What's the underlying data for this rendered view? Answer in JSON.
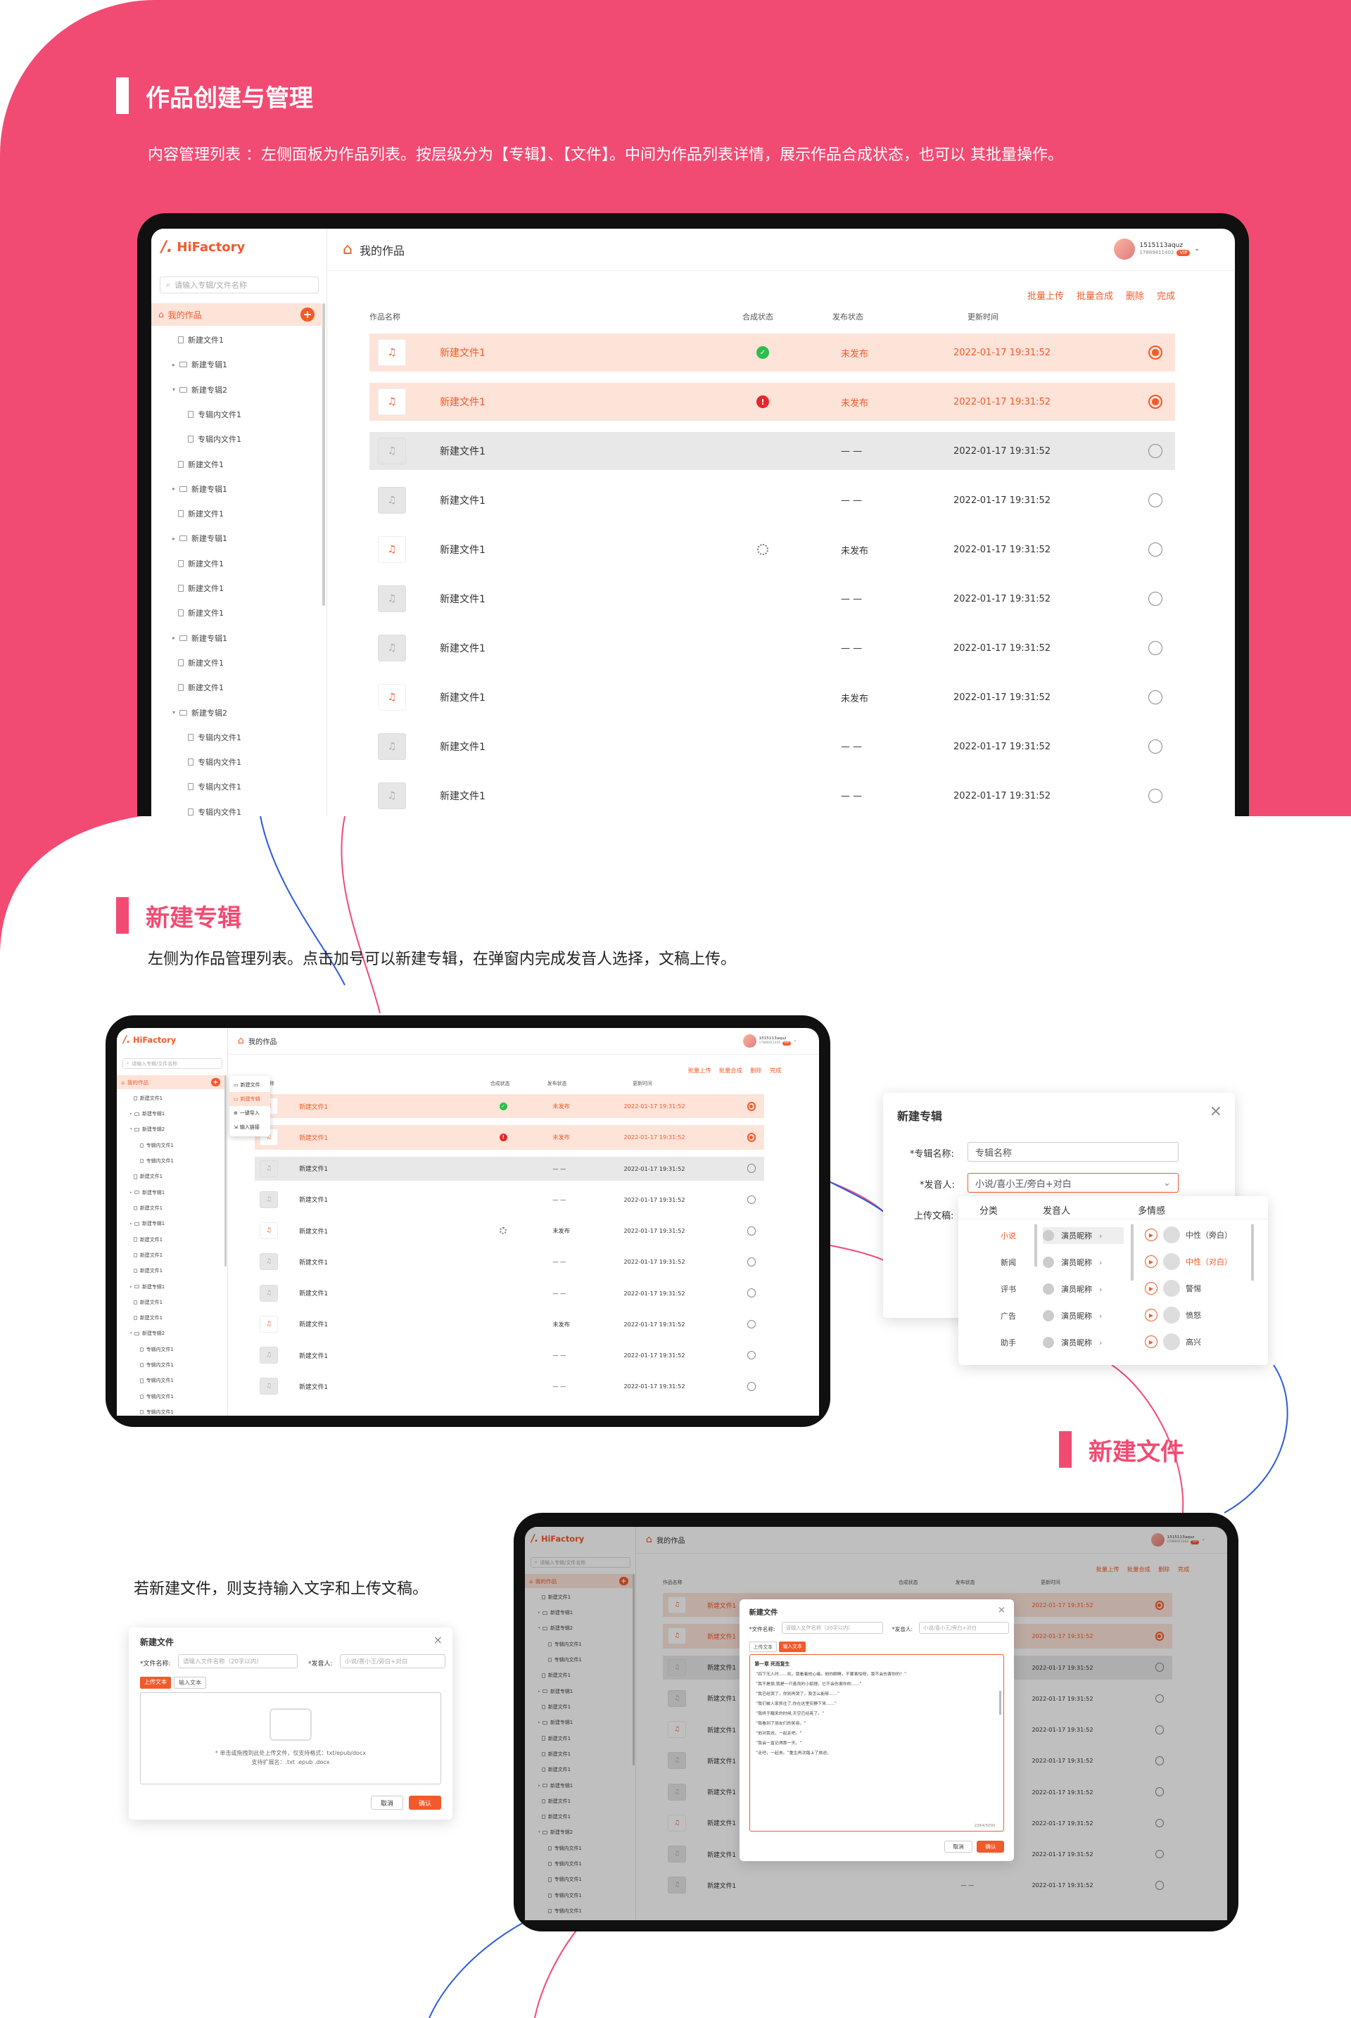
{
  "section1": {
    "title": "作品创建与管理",
    "desc": "内容管理列表 ：左侧面板为作品列表。按层级分为【专辑】、【文件】。中间为作品列表详情，展示作品合成状态，也可以 其批量操作。"
  },
  "section2": {
    "title": "新建专辑",
    "desc": "左侧为作品管理列表。点击加号可以新建专辑，在弹窗内完成发音人选择，文稿上传。"
  },
  "section3": {
    "title": "新建文件",
    "desc": "若新建文件，则支持输入文字和上传文稿。"
  },
  "app": {
    "logo": "HiFactory",
    "search_placeholder": "请输入专辑/文件名称",
    "my_works": "我的作品",
    "page_title": "我的作品",
    "user_name": "1515113aquz",
    "user_sub": "17889411402",
    "user_badge": "VIP",
    "actions": [
      "批量上传",
      "批量合成",
      "删除",
      "完成"
    ],
    "columns": {
      "name": "作品名称",
      "status": "合成状态",
      "publish": "发布状态",
      "updated": "更新时间"
    },
    "tree": [
      {
        "label": "新建文件1",
        "type": "file",
        "level": 1
      },
      {
        "label": "新建专辑1",
        "type": "album",
        "level": 1
      },
      {
        "label": "新建专辑2",
        "type": "album",
        "level": 1,
        "open": true
      },
      {
        "label": "专辑内文件1",
        "type": "file",
        "level": 2
      },
      {
        "label": "专辑内文件1",
        "type": "file",
        "level": 2
      },
      {
        "label": "新建文件1",
        "type": "file",
        "level": 1
      },
      {
        "label": "新建专辑1",
        "type": "album",
        "level": 1
      },
      {
        "label": "新建文件1",
        "type": "file",
        "level": 1
      },
      {
        "label": "新建专辑1",
        "type": "album",
        "level": 1
      },
      {
        "label": "新建文件1",
        "type": "file",
        "level": 1
      },
      {
        "label": "新建文件1",
        "type": "file",
        "level": 1
      },
      {
        "label": "新建文件1",
        "type": "file",
        "level": 1
      },
      {
        "label": "新建专辑1",
        "type": "album",
        "level": 1
      },
      {
        "label": "新建文件1",
        "type": "file",
        "level": 1
      },
      {
        "label": "新建文件1",
        "type": "file",
        "level": 1
      },
      {
        "label": "新建专辑2",
        "type": "album",
        "level": 1,
        "open": true
      },
      {
        "label": "专辑内文件1",
        "type": "file",
        "level": 2
      },
      {
        "label": "专辑内文件1",
        "type": "file",
        "level": 2
      },
      {
        "label": "专辑内文件1",
        "type": "file",
        "level": 2
      },
      {
        "label": "专辑内文件1",
        "type": "file",
        "level": 2
      },
      {
        "label": "专辑内文件1",
        "type": "file",
        "level": 2
      }
    ],
    "rows": [
      {
        "name": "新建文件1",
        "status": "ok",
        "publish": "未发布",
        "updated": "2022-01-17  19:31:52",
        "state": "selected",
        "thumb": "file"
      },
      {
        "name": "新建文件1",
        "status": "error",
        "publish": "未发布",
        "updated": "2022-01-17  19:31:52",
        "state": "selected",
        "thumb": "file"
      },
      {
        "name": "新建文件1",
        "status": "",
        "publish": "— —",
        "updated": "2022-01-17  19:31:52",
        "state": "hover",
        "thumb": "album"
      },
      {
        "name": "新建文件1",
        "status": "",
        "publish": "— —",
        "updated": "2022-01-17  19:31:52",
        "state": "",
        "thumb": "album"
      },
      {
        "name": "新建文件1",
        "status": "loading",
        "publish": "未发布",
        "updated": "2022-01-17  19:31:52",
        "state": "",
        "thumb": "file"
      },
      {
        "name": "新建文件1",
        "status": "",
        "publish": "— —",
        "updated": "2022-01-17  19:31:52",
        "state": "",
        "thumb": "album"
      },
      {
        "name": "新建文件1",
        "status": "",
        "publish": "— —",
        "updated": "2022-01-17  19:31:52",
        "state": "",
        "thumb": "album"
      },
      {
        "name": "新建文件1",
        "status": "",
        "publish": "未发布",
        "updated": "2022-01-17  19:31:52",
        "state": "",
        "thumb": "file"
      },
      {
        "name": "新建文件1",
        "status": "",
        "publish": "— —",
        "updated": "2022-01-17  19:31:52",
        "state": "",
        "thumb": "album"
      },
      {
        "name": "新建文件1",
        "status": "",
        "publish": "— —",
        "updated": "2022-01-17  19:31:52",
        "state": "",
        "thumb": "album"
      }
    ],
    "add_menu": [
      "新建文件",
      "新建专辑",
      "一键导入",
      "输入链接"
    ]
  },
  "album_dialog": {
    "title": "新建专辑",
    "close": "×",
    "name_label": "*专辑名称:",
    "name_value": "专辑名称",
    "voice_label": "*发音人:",
    "voice_value": "小说/喜小王/旁白+对白",
    "upload_label": "上传文稿:",
    "picker_headers": [
      "分类",
      "发音人",
      "多情感"
    ],
    "categories": [
      "小说",
      "新闻",
      "评书",
      "广告",
      "助手"
    ],
    "speakers": [
      "演员昵称",
      "演员昵称",
      "演员昵称",
      "演员昵称",
      "演员昵称"
    ],
    "emotions": [
      "中性（旁白）",
      "中性（对白）",
      "警惕",
      "愤怒",
      "高兴"
    ]
  },
  "file_dialog": {
    "title": "新建文件",
    "close": "×",
    "file_label": "*文件名称:",
    "file_placeholder": "请输入文件名称（20字以内）",
    "voice_label": "*发音人:",
    "voice_placeholder": "小说/喜小王/旁白+对白",
    "tabs": [
      "上传文本",
      "输入文本"
    ],
    "upload_hint": "* 单击或拖拽到此处上传文件，仅支持格式：txt/epub/docx",
    "upload_hint2": "支持扩展名：.txt .epub .docx",
    "cancel": "取消",
    "confirm": "确认",
    "chapter_title": "第一章  死而复生",
    "paragraphs": [
      "“四下无人时……吼，我看着他心痛，他的眼睛，不要害怕呀，我不会伤害你的！”",
      "“我不是狼,我是一只善良的小狐狸。它不会伤害你的……”",
      "“我已经哭了，你别再哭了，我怎么能够……”",
      "“我们被人家抓住了,你在这里安静下来……”",
      "“我终于醒来的时候,天空已经亮了。”",
      "“我看到了朋友们的笑容。”",
      "“他对我说，一起走吧。”",
      "“我会一直记得那一天。”",
      "“走吧，一起去。”重生再次踏上了旅途。"
    ],
    "counter": "2364/5000"
  }
}
